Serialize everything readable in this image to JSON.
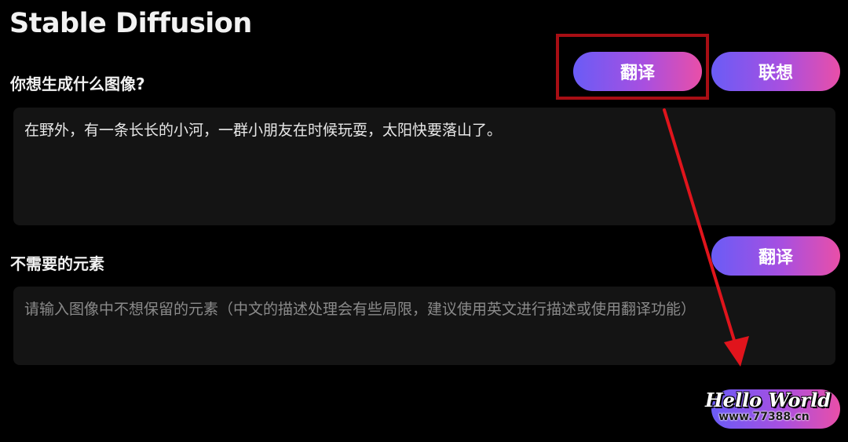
{
  "app": {
    "title": "Stable Diffusion"
  },
  "prompt_section": {
    "label": "你想生成什么图像?",
    "translate_button": "翻译",
    "associate_button": "联想",
    "value": "在野外，有一条长长的小河，一群小朋友在时候玩耍，太阳快要落山了。"
  },
  "negative_section": {
    "label": "不需要的元素",
    "translate_button": "翻译",
    "placeholder": "请输入图像中不想保留的元素（中文的描述处理会有些局限，建议使用英文进行描述或使用翻译功能）"
  },
  "generate_button": {
    "label": ""
  },
  "watermark": {
    "title": "Hello World",
    "url": "www.77388.cn"
  },
  "colors": {
    "background": "#000000",
    "panel": "#141414",
    "gradient_start": "#6a5cf6",
    "gradient_end": "#e94fa8",
    "annotation_red": "#e0141c"
  }
}
